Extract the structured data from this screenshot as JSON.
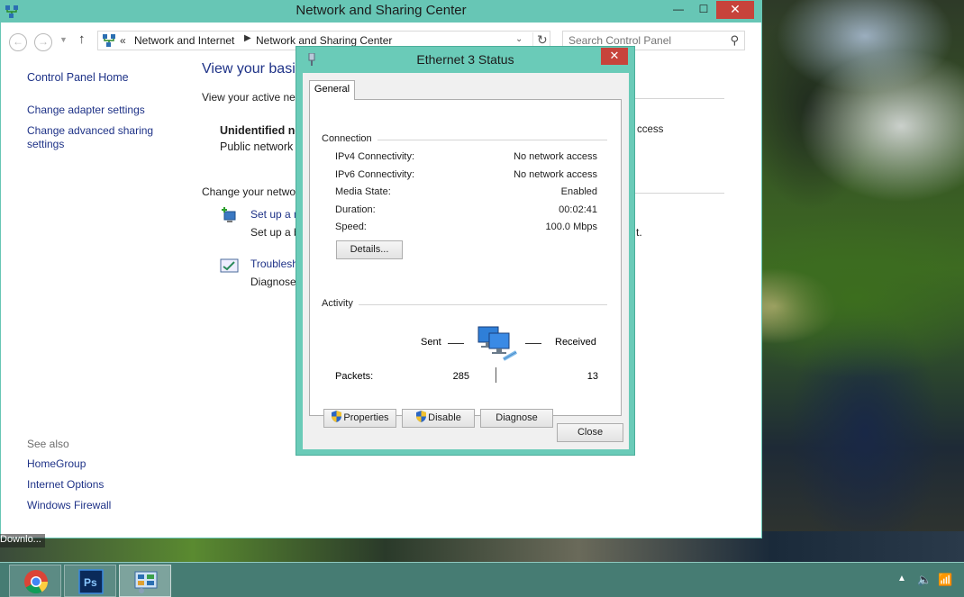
{
  "main_window": {
    "title": "Network and Sharing Center",
    "controls": {
      "minimize": "—",
      "maximize": "☐",
      "close": "✕"
    }
  },
  "address_bar": {
    "crumb_prefix": "«",
    "crumbs": [
      "Network and Internet",
      "Network and Sharing Center"
    ],
    "search_placeholder": "Search Control Panel"
  },
  "left_nav": {
    "home": "Control Panel Home",
    "links": [
      "Change adapter settings",
      "Change advanced sharing",
      "settings"
    ],
    "see_also_label": "See also",
    "see_also": [
      "HomeGroup",
      "Internet Options",
      "Windows Firewall"
    ]
  },
  "content": {
    "title": "View your basic",
    "active_networks": "View your active net",
    "network_name": "Unidentified ne",
    "network_type": "Public network",
    "access_tail": "ccess",
    "change_settings": "Change your netwo",
    "setup_link": "Set up a n",
    "setup_desc": "Set up a b",
    "setup_tail": "t.",
    "trouble_link": "Troublesh",
    "trouble_desc": "Diagnose"
  },
  "dialog": {
    "title": "Ethernet 3 Status",
    "tab": "General",
    "connection_label": "Connection",
    "properties": [
      {
        "label": "IPv4 Connectivity:",
        "value": "No network access"
      },
      {
        "label": "IPv6 Connectivity:",
        "value": "No network access"
      },
      {
        "label": "Media State:",
        "value": "Enabled"
      },
      {
        "label": "Duration:",
        "value": "00:02:41"
      },
      {
        "label": "Speed:",
        "value": "100.0 Mbps"
      }
    ],
    "details_button": "Details...",
    "activity_label": "Activity",
    "sent_label": "Sent",
    "received_label": "Received",
    "packets_label": "Packets:",
    "packets_sent": "285",
    "packets_received": "13",
    "buttons": {
      "properties": "Properties",
      "disable": "Disable",
      "diagnose": "Diagnose",
      "close": "Close"
    }
  },
  "taskbar": {
    "download_tip": "Downlo...",
    "apps": [
      "Google Chrome",
      "Photoshop",
      "Control Panel"
    ],
    "ps_label": "Ps"
  },
  "colors": {
    "title_accent": "#67c6b5",
    "dialog_accent": "#6acbb8",
    "close_red": "#c7433b",
    "link_blue": "#1e3287",
    "taskbar": "#48827a"
  }
}
